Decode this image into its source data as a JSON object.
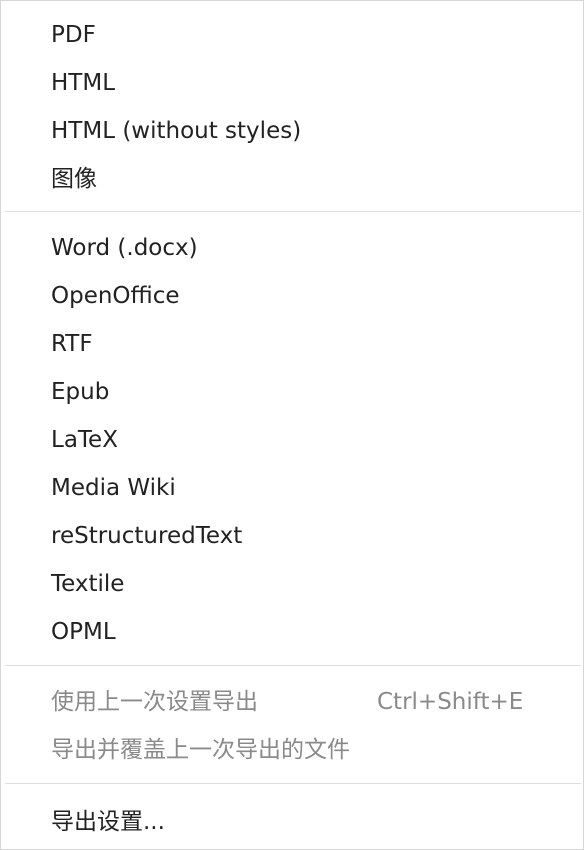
{
  "menu": {
    "group1": [
      {
        "label": "PDF"
      },
      {
        "label": "HTML"
      },
      {
        "label": "HTML (without styles)"
      },
      {
        "label": "图像"
      }
    ],
    "group2": [
      {
        "label": "Word (.docx)"
      },
      {
        "label": "OpenOffice"
      },
      {
        "label": "RTF"
      },
      {
        "label": "Epub"
      },
      {
        "label": "LaTeX"
      },
      {
        "label": "Media Wiki"
      },
      {
        "label": "reStructuredText"
      },
      {
        "label": "Textile"
      },
      {
        "label": "OPML"
      }
    ],
    "group3": [
      {
        "label": "使用上一次设置导出",
        "shortcut": "Ctrl+Shift+E",
        "enabled": false
      },
      {
        "label": "导出并覆盖上一次导出的文件",
        "enabled": false
      }
    ],
    "group4": [
      {
        "label": "导出设置..."
      }
    ]
  }
}
